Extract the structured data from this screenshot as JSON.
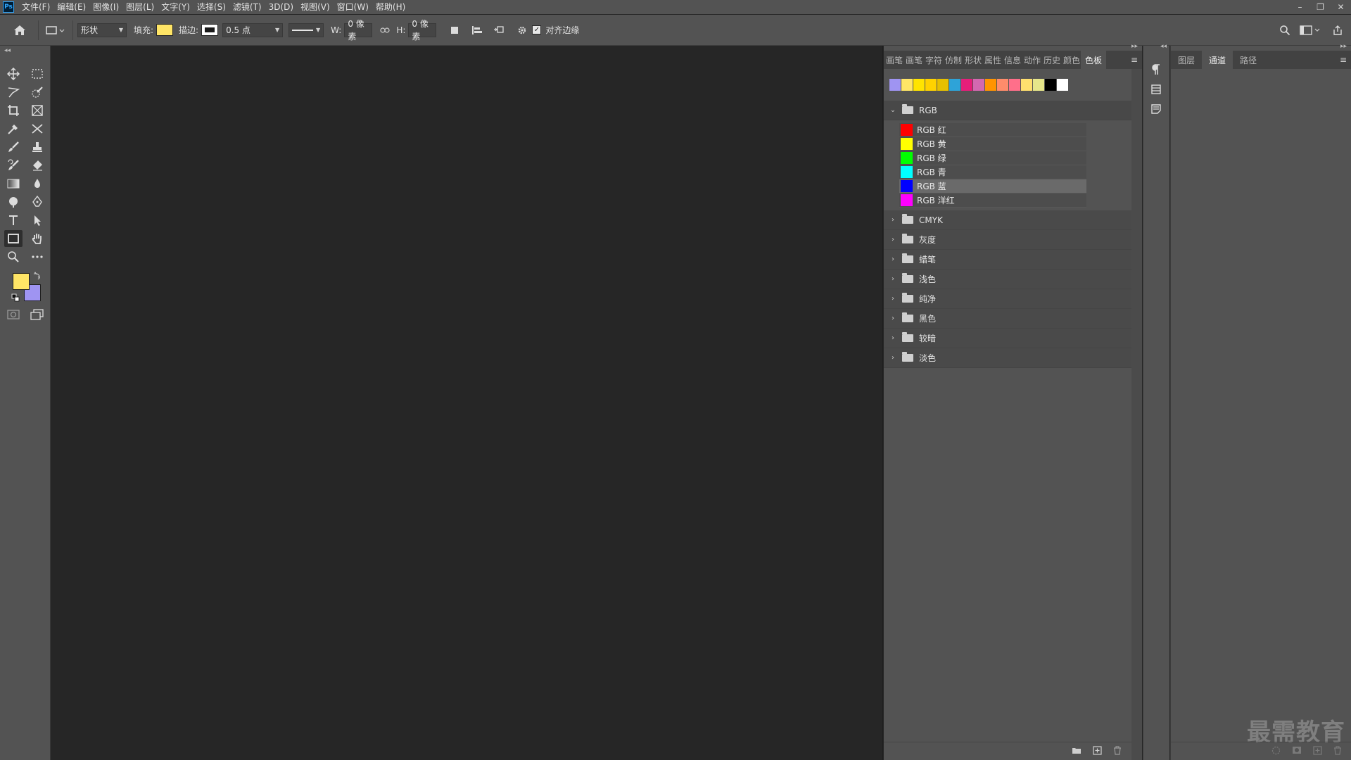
{
  "app": {
    "logo": "Ps"
  },
  "menu": [
    "文件(F)",
    "编辑(E)",
    "图像(I)",
    "图层(L)",
    "文字(Y)",
    "选择(S)",
    "滤镜(T)",
    "3D(D)",
    "视图(V)",
    "窗口(W)",
    "帮助(H)"
  ],
  "window_controls": {
    "minimize": "–",
    "restore": "❐",
    "close": "✕"
  },
  "options": {
    "mode": "形状",
    "fill_label": "填充:",
    "fill_color": "#ffe566",
    "stroke_label": "描边:",
    "stroke_size": "0.5 点",
    "w_label": "W:",
    "w_value": "0 像素",
    "h_label": "H:",
    "h_value": "0 像素",
    "align_edges_label": "对齐边缘",
    "align_edges_checked": true
  },
  "colors": {
    "foreground": "#ffe566",
    "background": "#9f94f2"
  },
  "swatches_panel": {
    "tabs": [
      "画笔",
      "画笔",
      "字符",
      "仿制",
      "形状",
      "属性",
      "信息",
      "动作",
      "历史",
      "颜色",
      "色板"
    ],
    "active_tab": "色板",
    "recent": [
      "#9f94f2",
      "#ffe566",
      "#ffe400",
      "#ffd200",
      "#e6c000",
      "#2ea3d8",
      "#e61e7a",
      "#d368b0",
      "#ff9400",
      "#ff8c6b",
      "#ff6f8a",
      "#ffdf6e",
      "#e6e68a",
      "#000000",
      "#ffffff"
    ],
    "groups": [
      {
        "name": "RGB",
        "expanded": true
      },
      {
        "name": "CMYK"
      },
      {
        "name": "灰度"
      },
      {
        "name": "蜡笔"
      },
      {
        "name": "浅色"
      },
      {
        "name": "纯净"
      },
      {
        "name": "黑色"
      },
      {
        "name": "较暗"
      },
      {
        "name": "淡色"
      }
    ],
    "rgb_swatches": [
      {
        "name": "RGB 红",
        "color": "#ff0000"
      },
      {
        "name": "RGB 黄",
        "color": "#ffff00"
      },
      {
        "name": "RGB 绿",
        "color": "#00ff00"
      },
      {
        "name": "RGB 青",
        "color": "#00ffff"
      },
      {
        "name": "RGB 蓝",
        "color": "#0000ff",
        "selected": true
      },
      {
        "name": "RGB 洋红",
        "color": "#ff00ff"
      }
    ]
  },
  "right_panel": {
    "tabs": [
      "图层",
      "通道",
      "路径"
    ],
    "active_tab": "通道"
  },
  "watermark": "最需教育"
}
